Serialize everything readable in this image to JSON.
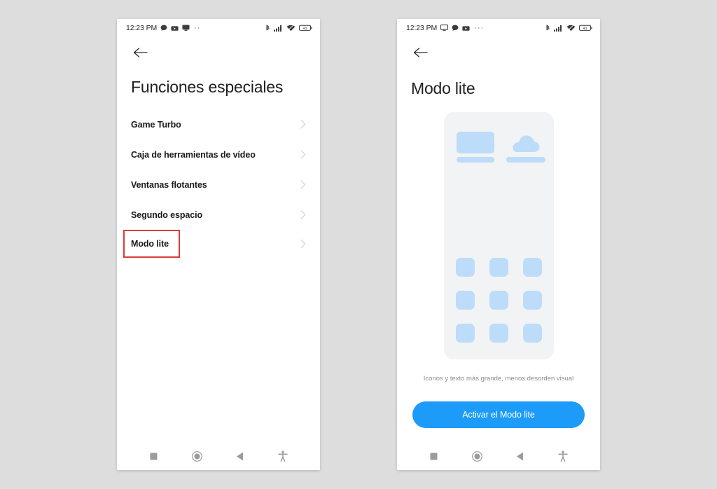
{
  "background_color": "#dddddd",
  "accent_color": "#1d9bf8",
  "highlight_color": "#e03a3a",
  "illustration_blue": "#bddcfa",
  "phones": {
    "left": {
      "status_bar": {
        "time": "12:23 PM",
        "left_icons": [
          "chat-bubble-icon",
          "video-icon",
          "cast-screen-icon"
        ],
        "overflow": "··",
        "right_icons": [
          "bluetooth-icon",
          "signal-bars-icon",
          "wifi-icon",
          "battery-icon"
        ],
        "battery_level": "43"
      },
      "back_icon": "back-arrow-icon",
      "title": "Funciones especiales",
      "list": [
        {
          "label": "Game Turbo",
          "chevron": "chevron-right-icon",
          "highlighted": false
        },
        {
          "label": "Caja de herramientas de vídeo",
          "chevron": "chevron-right-icon",
          "highlighted": false
        },
        {
          "label": "Ventanas flotantes",
          "chevron": "chevron-right-icon",
          "highlighted": false
        },
        {
          "label": "Segundo espacio",
          "chevron": "chevron-right-icon",
          "highlighted": false
        },
        {
          "label": "Modo lite",
          "chevron": "chevron-right-icon",
          "highlighted": true
        }
      ],
      "nav_bar": [
        "recents-square-icon",
        "home-circle-icon",
        "back-triangle-icon",
        "accessibility-icon"
      ]
    },
    "right": {
      "status_bar": {
        "time": "12:23 PM",
        "left_icons": [
          "cast-screen-icon",
          "chat-bubble-icon",
          "video-icon"
        ],
        "overflow": "···",
        "right_icons": [
          "bluetooth-icon",
          "signal-bars-icon",
          "wifi-icon",
          "battery-icon"
        ],
        "battery_level": "43"
      },
      "back_icon": "back-arrow-icon",
      "title": "Modo lite",
      "illustration": {
        "top_shapes": [
          "rounded-rectangle-shape",
          "cloud-shape",
          "bar-shape",
          "bar-shape"
        ],
        "app_grid_count": 9
      },
      "caption": "Iconos y texto más grande, menos desorden visual",
      "cta_label": "Activar el Modo lite",
      "nav_bar": [
        "recents-square-icon",
        "home-circle-icon",
        "back-triangle-icon",
        "accessibility-icon"
      ]
    }
  }
}
